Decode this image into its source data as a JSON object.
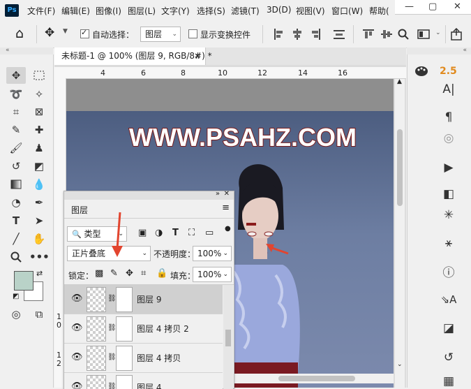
{
  "app": {
    "logo": "Ps"
  },
  "menu": [
    "文件(F)",
    "编辑(E)",
    "图像(I)",
    "图层(L)",
    "文字(Y)",
    "选择(S)",
    "滤镜(T)",
    "3D(D)",
    "视图(V)",
    "窗口(W)",
    "帮助("
  ],
  "window_controls": {
    "minimize": "—",
    "restore": "▢",
    "close": "✕"
  },
  "options": {
    "home": "⌂",
    "move": "✥",
    "auto_select_label": "自动选择：",
    "auto_select_checked": true,
    "target": "图层",
    "show_transform_label": "显示变换控件",
    "show_transform_checked": false
  },
  "document": {
    "tab_title": "未标题-1 @ 100% (图层 9, RGB/8#) *",
    "tab_close": "×",
    "ruler_top": [
      "4",
      "6",
      "8",
      "10",
      "12",
      "14",
      "16"
    ],
    "ruler_left": [
      "1",
      "0",
      "1",
      "2"
    ],
    "watermark": "WWW.PSAHZ.COM"
  },
  "right_panel": {
    "brush_size": "2.5"
  },
  "layers_panel": {
    "title": "图层",
    "filter_kind": "类型",
    "blend_mode": "正片叠底",
    "opacity_label": "不透明度：",
    "opacity_value": "100%",
    "lock_label": "锁定：",
    "fill_label": "填充：",
    "fill_value": "100%",
    "layers": [
      {
        "name": "图层 9",
        "selected": true
      },
      {
        "name": "图层 4 拷贝 2",
        "selected": false
      },
      {
        "name": "图层 4 拷贝",
        "selected": false
      },
      {
        "name": "图层 4",
        "selected": false
      }
    ]
  },
  "colors": {
    "foreground": "#b9d2c8",
    "background": "#ffffff",
    "annotation_arrow": "#e2452f",
    "watermark_fill": "#ffffff",
    "watermark_outline": "#7a1a1a"
  }
}
